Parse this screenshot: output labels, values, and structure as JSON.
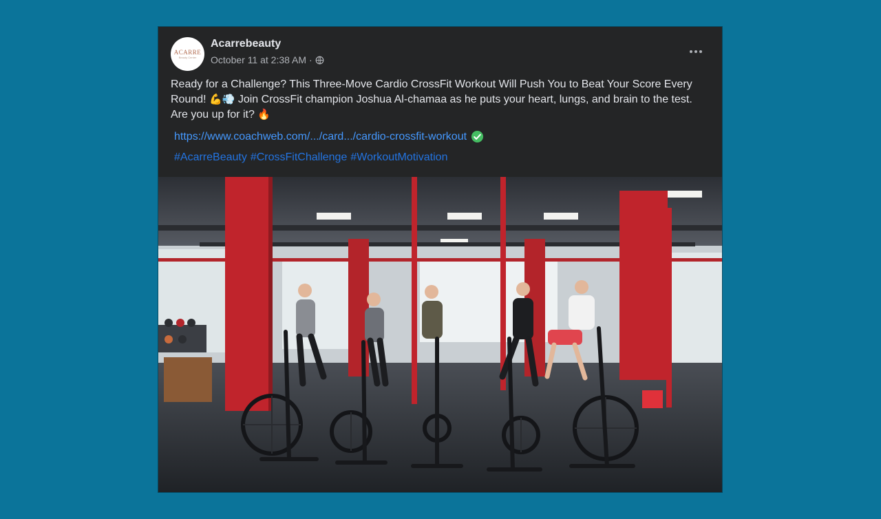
{
  "post": {
    "page_name": "Acarrebeauty",
    "timestamp": "October 11 at 2:38 AM",
    "separator": "·",
    "avatar_logo": "ACARRE",
    "avatar_sub": "Beauty Center",
    "text_part1": "Ready for a Challenge? This Three-Move Cardio CrossFit Workout Will Push You to Beat Your Score Every Round! ",
    "emoji1": "💪💨",
    "text_part2": " Join CrossFit champion Joshua Al-chamaa as he puts your heart, lungs, and brain to the test. Are you up for it? ",
    "emoji2": "🔥",
    "link": "https://www.coachweb.com/.../card.../cardio-crossfit-workout",
    "hashtags": [
      "#AcarreBeauty",
      "#CrossFitChallenge",
      "#WorkoutMotivation"
    ]
  },
  "icons": {
    "more": "more-options-icon",
    "privacy": "globe-icon",
    "verified": "check-circle-icon"
  },
  "colors": {
    "background": "#0b749a",
    "card": "#242526",
    "link": "#4599ff",
    "hashtag": "#2374e1",
    "check": "#45bd62"
  }
}
